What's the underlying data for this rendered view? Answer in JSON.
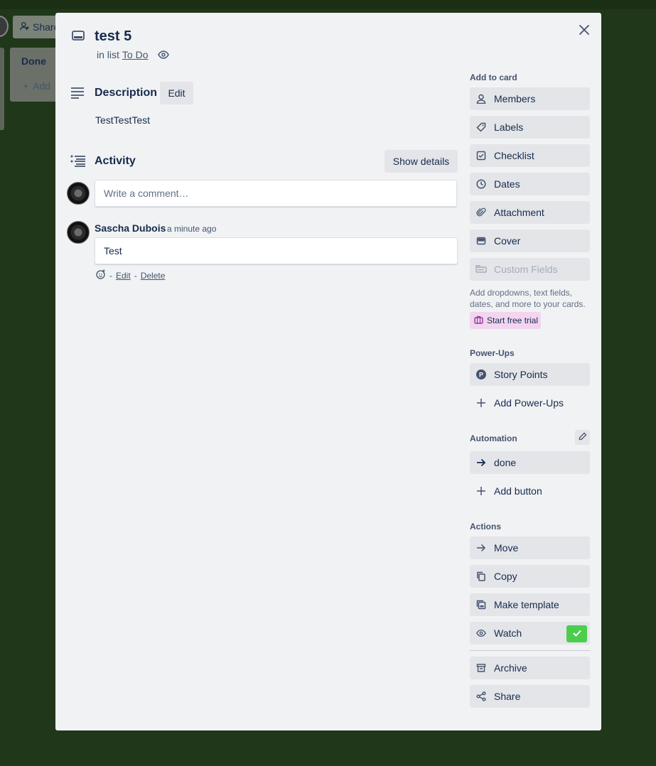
{
  "background": {
    "share_label": "Share",
    "list_title": "Done",
    "add_label": "Add"
  },
  "card": {
    "title": "test 5",
    "in_list_prefix": "in list",
    "list_name": "To Do"
  },
  "description": {
    "heading": "Description",
    "edit_label": "Edit",
    "text": "TestTestTest"
  },
  "activity": {
    "heading": "Activity",
    "show_details_label": "Show details",
    "comment_placeholder": "Write a comment…",
    "comments": [
      {
        "author": "Sascha Dubois",
        "timestamp": "a minute ago",
        "text": "Test",
        "edit_label": "Edit",
        "delete_label": "Delete",
        "separator": "-"
      }
    ]
  },
  "sidebar": {
    "add_to_card": {
      "heading": "Add to card",
      "items": [
        {
          "label": "Members",
          "icon": "person-icon"
        },
        {
          "label": "Labels",
          "icon": "tag-icon"
        },
        {
          "label": "Checklist",
          "icon": "checkbox-icon"
        },
        {
          "label": "Dates",
          "icon": "clock-icon"
        },
        {
          "label": "Attachment",
          "icon": "paperclip-icon"
        },
        {
          "label": "Cover",
          "icon": "cover-icon"
        },
        {
          "label": "Custom Fields",
          "icon": "custom-fields-icon",
          "disabled": true
        }
      ],
      "note": "Add dropdowns, text fields, dates, and more to your cards.",
      "trial_label": "Start free trial"
    },
    "power_ups": {
      "heading": "Power-Ups",
      "items": [
        {
          "label": "Story Points",
          "icon": "story-points-icon"
        },
        {
          "label": "Add Power-Ups",
          "icon": "plus-icon"
        }
      ]
    },
    "automation": {
      "heading": "Automation",
      "items": [
        {
          "label": "done",
          "icon": "arrow-right-icon"
        },
        {
          "label": "Add button",
          "icon": "plus-icon"
        }
      ]
    },
    "actions": {
      "heading": "Actions",
      "items": [
        {
          "label": "Move",
          "icon": "arrow-right-icon"
        },
        {
          "label": "Copy",
          "icon": "copy-icon"
        },
        {
          "label": "Make template",
          "icon": "template-icon"
        },
        {
          "label": "Watch",
          "icon": "eye-icon",
          "checked": true
        },
        {
          "label": "Archive",
          "icon": "archive-icon"
        },
        {
          "label": "Share",
          "icon": "share-icon"
        }
      ]
    }
  },
  "colors": {
    "board_background": "#20371a",
    "modal_background": "#f1f2f4",
    "button_background": "#e3e5e8",
    "watch_check": "#4bce4b",
    "trial_background": "#f3d5f0"
  }
}
